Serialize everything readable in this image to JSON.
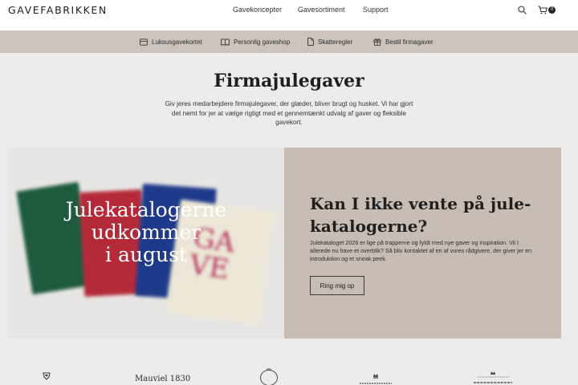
{
  "header": {
    "logo": "GAVEFABRIKKEN",
    "nav": [
      "Gavekoncepter",
      "Gavesortiment",
      "Support"
    ],
    "cart_count": "0"
  },
  "subnav": [
    "Luksusgavekortet",
    "Personlig gaveshop",
    "Skatteregler",
    "Bestil firmagaver"
  ],
  "main": {
    "title": "Firmajulegaver",
    "intro": "Giv jeres medarbejdere firmajulegaver, der glæder, bliver brugt og husket. Vi har gjort det nemt for jer at vælge rigtigt med et gennemtænkt udvalg af gaver og fleksible gavekort."
  },
  "hero": {
    "image_overlay": [
      "Julekatalogerne",
      "udkommer",
      "i august"
    ],
    "image_lettering": "GAVE",
    "heading": "Kan I ikke vente på jule-katalogerne?",
    "text": "Julekataloget 2026 er lige på trapperne og fyldt med nye gaver og inspiration. Vil I allerede nu have et overblik? Så bliv kontaktet af en af vores rådgivere, der giver jer en introduktion og et sneak peek.",
    "button": "Ring mig op"
  },
  "brands": [
    "Mauviel 1830"
  ],
  "colors": {
    "subnav_bg": "#cbc3bc",
    "panel_bg": "#c8bdb4",
    "page_bg": "#ececec"
  }
}
